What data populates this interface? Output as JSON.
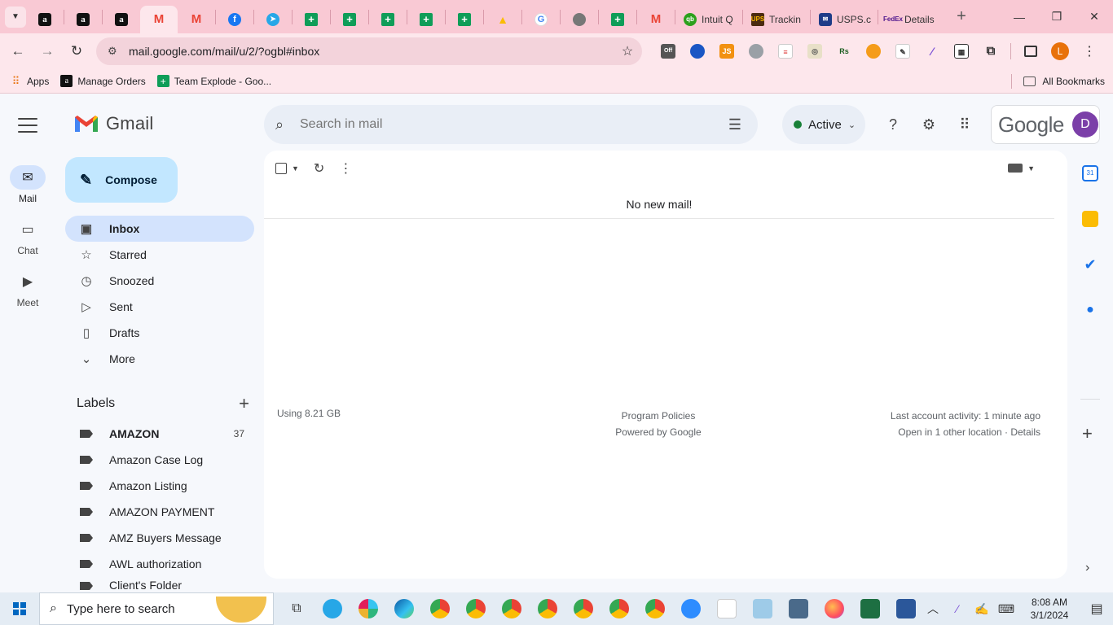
{
  "browser": {
    "tabs": [
      {
        "icon": "amazon-icon",
        "title": ""
      },
      {
        "icon": "amazon-icon",
        "title": ""
      },
      {
        "icon": "amazon-icon",
        "title": ""
      },
      {
        "icon": "gmail-icon",
        "title": "",
        "active": true
      },
      {
        "icon": "gmail-icon",
        "title": ""
      },
      {
        "icon": "facebook-icon",
        "title": ""
      },
      {
        "icon": "telegram-icon",
        "title": ""
      },
      {
        "icon": "sheets-icon",
        "title": ""
      },
      {
        "icon": "sheets-icon",
        "title": ""
      },
      {
        "icon": "sheets-icon",
        "title": ""
      },
      {
        "icon": "sheets-icon",
        "title": ""
      },
      {
        "icon": "sheets-icon",
        "title": ""
      },
      {
        "icon": "drive-icon",
        "title": ""
      },
      {
        "icon": "google-icon",
        "title": ""
      },
      {
        "icon": "globe-icon",
        "title": ""
      },
      {
        "icon": "sheets-icon",
        "title": ""
      },
      {
        "icon": "gmail-icon",
        "title": ""
      },
      {
        "icon": "quickbooks-icon",
        "title": "Intuit Q"
      },
      {
        "icon": "ups-icon",
        "title": "Trackin"
      },
      {
        "icon": "usps-icon",
        "title": "USPS.c"
      },
      {
        "icon": "fedex-icon",
        "title": "Details"
      }
    ],
    "url": "mail.google.com/mail/u/2/?ogbl#inbox",
    "bookmarks": [
      {
        "icon": "apps-grid-icon",
        "label": "Apps"
      },
      {
        "icon": "amazon-icon",
        "label": "Manage Orders"
      },
      {
        "icon": "sheets-icon",
        "label": "Team Explode - Goo..."
      }
    ],
    "all_bookmarks_label": "All Bookmarks",
    "profile_initial": "L"
  },
  "gmail": {
    "product_name": "Gmail",
    "rail": [
      {
        "icon": "mail-icon",
        "label": "Mail",
        "active": true
      },
      {
        "icon": "chat-icon",
        "label": "Chat",
        "active": false
      },
      {
        "icon": "meet-icon",
        "label": "Meet",
        "active": false
      }
    ],
    "compose_label": "Compose",
    "nav": [
      {
        "icon": "inbox-icon",
        "label": "Inbox",
        "active": true
      },
      {
        "icon": "star-icon",
        "label": "Starred",
        "active": false
      },
      {
        "icon": "clock-icon",
        "label": "Snoozed",
        "active": false
      },
      {
        "icon": "send-icon",
        "label": "Sent",
        "active": false
      },
      {
        "icon": "draft-icon",
        "label": "Drafts",
        "active": false
      },
      {
        "icon": "chevron-down-icon",
        "label": "More",
        "active": false
      }
    ],
    "labels_title": "Labels",
    "labels": [
      {
        "name": "AMAZON",
        "count": "37",
        "bold": true
      },
      {
        "name": "Amazon Case Log",
        "count": "",
        "bold": false
      },
      {
        "name": "Amazon Listing",
        "count": "",
        "bold": false
      },
      {
        "name": "AMAZON PAYMENT",
        "count": "",
        "bold": false
      },
      {
        "name": "AMZ Buyers Message",
        "count": "",
        "bold": false
      },
      {
        "name": "AWL authorization",
        "count": "",
        "bold": false
      },
      {
        "name": "Client's Folder",
        "count": "",
        "bold": false
      }
    ],
    "search_placeholder": "Search in mail",
    "status_label": "Active",
    "google_word": "Google",
    "avatar_initial": "D",
    "empty_message": "No new mail!",
    "storage": "Using 8.21 GB",
    "program_policies": "Program Policies",
    "powered_by": "Powered by Google",
    "last_activity": "Last account activity: 1 minute ago",
    "other_location": "Open in 1 other location · Details"
  },
  "taskbar": {
    "search_placeholder": "Type here to search",
    "time": "8:08 AM",
    "date": "3/1/2024"
  }
}
